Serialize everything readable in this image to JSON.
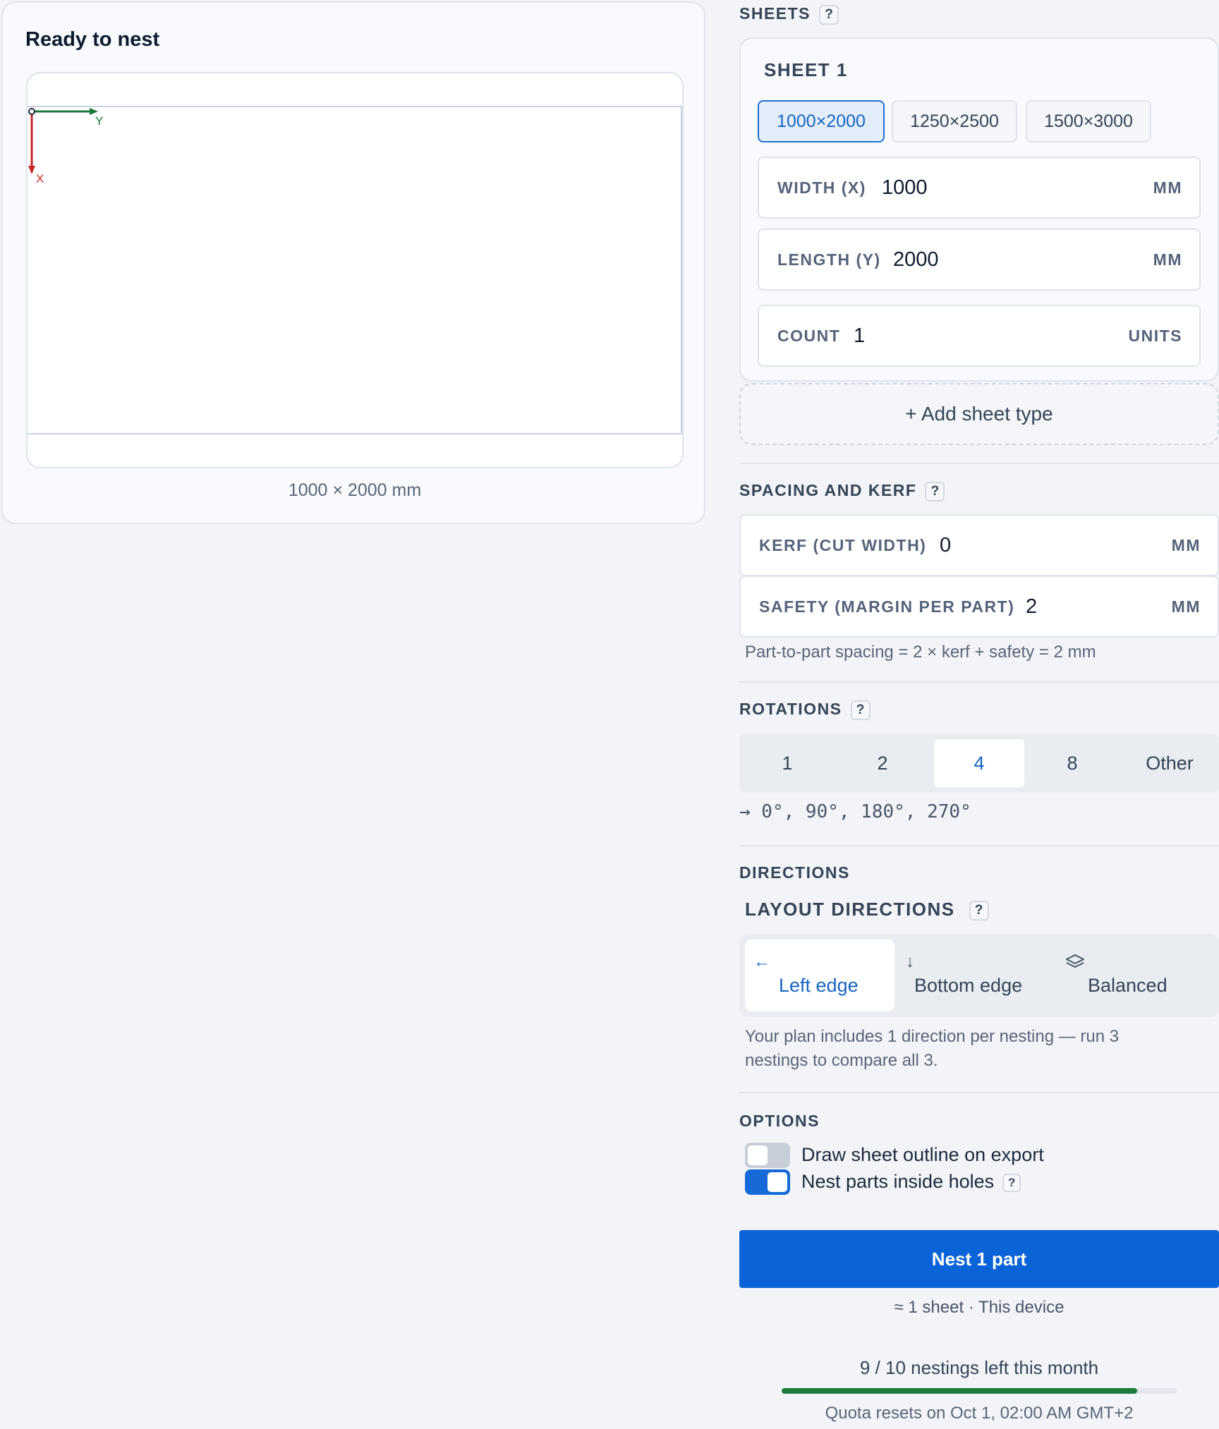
{
  "preview": {
    "title": "Ready to nest",
    "axis_y_label": "Y",
    "axis_x_label": "X",
    "dimensions_caption": "1000 × 2000 mm"
  },
  "sheets": {
    "heading": "SHEETS",
    "help": "?",
    "sheet_title": "SHEET 1",
    "presets": [
      "1000×2000",
      "1250×2500",
      "1500×3000"
    ],
    "active_preset": "1000×2000",
    "width": {
      "label": "WIDTH (X)",
      "value": "1000",
      "unit": "MM"
    },
    "length": {
      "label": "LENGTH (Y)",
      "value": "2000",
      "unit": "MM"
    },
    "count": {
      "label": "COUNT",
      "value": "1",
      "unit": "UNITS"
    },
    "add_label": "+ Add sheet type"
  },
  "spacing": {
    "heading": "SPACING AND KERF",
    "help": "?",
    "kerf": {
      "label": "KERF (CUT WIDTH)",
      "value": "0",
      "unit": "MM"
    },
    "safety": {
      "label": "SAFETY (MARGIN PER PART)",
      "value": "2",
      "unit": "MM"
    },
    "hint": "Part-to-part spacing = 2 × kerf + safety = 2 mm"
  },
  "rotations": {
    "heading": "ROTATIONS",
    "help": "?",
    "options": [
      "1",
      "2",
      "4",
      "8",
      "Other"
    ],
    "selected": "4",
    "result": "→ 0°, 90°, 180°, 270°"
  },
  "directions": {
    "heading": "DIRECTIONS",
    "subheading": "LAYOUT DIRECTIONS",
    "help": "?",
    "options": [
      {
        "icon": "arrow-left-icon",
        "label": "Left edge"
      },
      {
        "icon": "arrow-down-icon",
        "label": "Bottom edge"
      },
      {
        "icon": "layers-icon",
        "label": "Balanced"
      }
    ],
    "selected": "Left edge",
    "hint_line1": "Your plan includes 1 direction per nesting — run 3",
    "hint_line2": "nestings to compare all 3."
  },
  "options": {
    "heading": "OPTIONS",
    "draw_outline": {
      "label": "Draw sheet outline on export",
      "enabled": false
    },
    "nest_holes": {
      "label": "Nest parts inside holes",
      "enabled": true
    },
    "help": "?"
  },
  "action": {
    "button_label": "Nest 1 part",
    "estimate": "≈ 1 sheet · This device"
  },
  "quota": {
    "text": "9 / 10 nestings left this month",
    "used_fraction": 0.9,
    "reset_text": "Quota resets on Oct 1, 02:00 AM GMT+2"
  },
  "colors": {
    "accent": "#0a64d8",
    "axis_x": "#c62828",
    "axis_y": "#1b7a3a",
    "quota_bar": "#1c7a3c"
  }
}
